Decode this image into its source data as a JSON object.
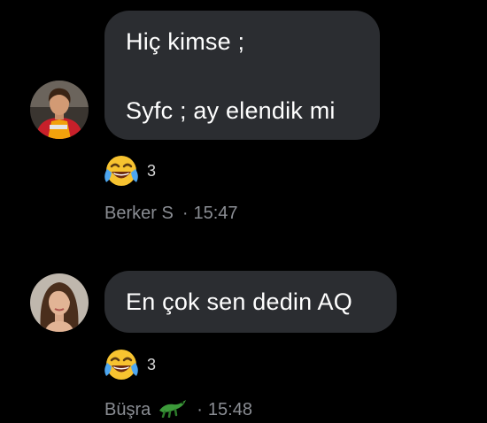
{
  "colors": {
    "background": "#000000",
    "bubble": "#2b2d31",
    "meta_text": "#8a8d93",
    "reaction_count": "#d6d6d6"
  },
  "messages": [
    {
      "sender": "Berker S",
      "time": "15:47",
      "separator": "·",
      "avatar_icon": "profile-photo-footballer",
      "lines": [
        "Hiç kimse ;",
        "Syfc ; ay elendik mi"
      ],
      "reaction": {
        "emoji": "face-with-tears-of-joy",
        "count": "3"
      }
    },
    {
      "sender": "Büşra",
      "sender_badge": "crocodile-icon",
      "time": "15:48",
      "separator": "·",
      "avatar_icon": "profile-photo-woman",
      "lines": [
        "En çok sen dedin AQ"
      ],
      "reaction": {
        "emoji": "face-with-tears-of-joy",
        "count": "3"
      }
    }
  ]
}
